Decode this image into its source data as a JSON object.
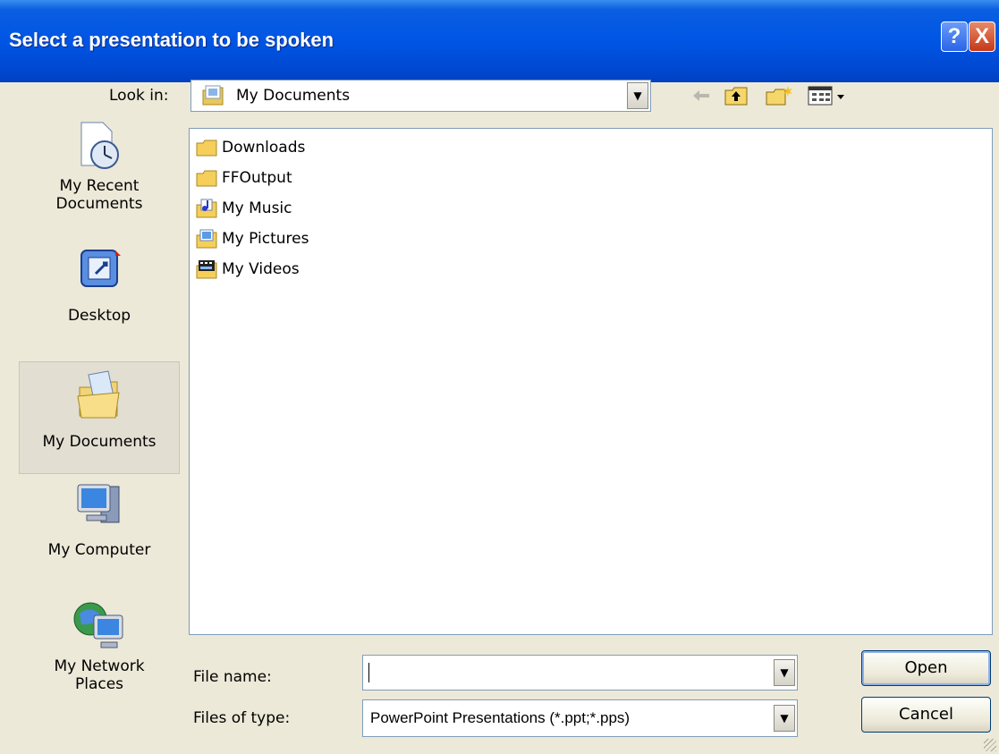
{
  "window": {
    "title": "Select a presentation to be spoken",
    "help_glyph": "?",
    "close_glyph": "X"
  },
  "toolbar": {
    "look_in_label": "Look in:",
    "look_in_value": "My Documents",
    "look_in_icon": "my-documents-icon",
    "back_icon": "back-arrow-icon",
    "up_icon": "up-folder-icon",
    "new_folder_icon": "new-folder-icon",
    "views_icon": "views-menu-icon"
  },
  "places": [
    {
      "label_line1": "My Recent",
      "label_line2": "Documents",
      "icon": "recent-documents-icon"
    },
    {
      "label_line1": "Desktop",
      "label_line2": "",
      "icon": "desktop-icon"
    },
    {
      "label_line1": "My Documents",
      "label_line2": "",
      "icon": "my-documents-icon",
      "selected": true
    },
    {
      "label_line1": "My Computer",
      "label_line2": "",
      "icon": "my-computer-icon"
    },
    {
      "label_line1": "My Network",
      "label_line2": "Places",
      "icon": "network-places-icon"
    }
  ],
  "files": [
    {
      "name": "Downloads",
      "icon": "folder-icon"
    },
    {
      "name": "FFOutput",
      "icon": "folder-icon"
    },
    {
      "name": "My Music",
      "icon": "music-folder-icon"
    },
    {
      "name": "My Pictures",
      "icon": "pictures-folder-icon"
    },
    {
      "name": "My Videos",
      "icon": "videos-folder-icon"
    }
  ],
  "form": {
    "file_name_label": "File name:",
    "file_name_value": "",
    "file_type_label": "Files of type:",
    "file_type_value": "PowerPoint Presentations (*.ppt;*.pps)"
  },
  "buttons": {
    "open": "Open",
    "cancel": "Cancel"
  },
  "colors": {
    "titlebar": "#0055e5",
    "dialog_bg": "#ece9d8",
    "folder_yellow": "#f5cf5a"
  }
}
